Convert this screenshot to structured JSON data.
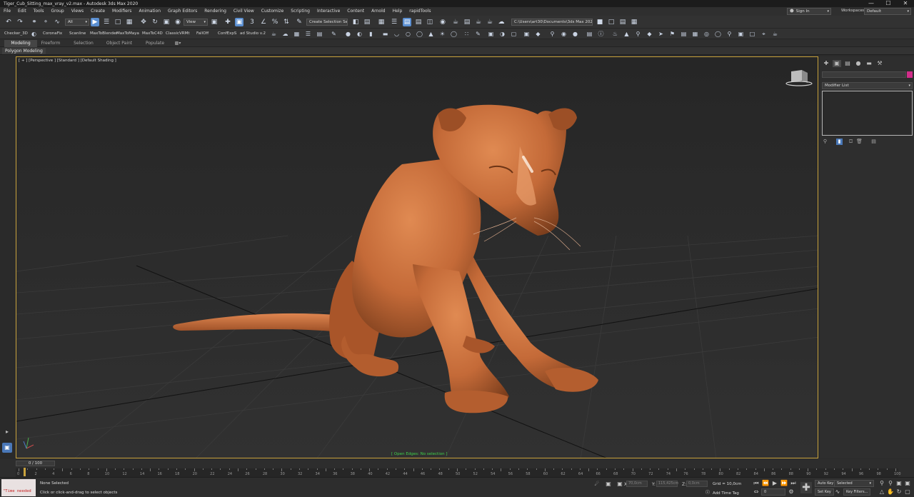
{
  "window": {
    "title": "Tiger_Cub_Sitting_max_vray_v2.max - Autodesk 3ds Max 2020",
    "buttons": {
      "minimize": "—",
      "maximize": "☐",
      "close": "✕"
    }
  },
  "menubar": {
    "items": [
      "File",
      "Edit",
      "Tools",
      "Group",
      "Views",
      "Create",
      "Modifiers",
      "Animation",
      "Graph Editors",
      "Rendering",
      "Civil View",
      "Customize",
      "Scripting",
      "Interactive",
      "Content",
      "Arnold",
      "Help",
      "rapidTools"
    ],
    "sign_in": "Sign In",
    "workspaces_label": "Workspaces:",
    "workspace_value": "Default"
  },
  "toolbar": {
    "selection_filter": "All",
    "ref_coord": "View",
    "named_selection": "Create Selection Se",
    "project_path": "C:\\Users\\art30\\Documents\\3ds Max 2020"
  },
  "toolbar2": {
    "labels": [
      "Checker_3D",
      "CoronaFix",
      "Scanline",
      "MaxToBlender",
      "MaxToMaya",
      "MaxToC4D",
      "ClassicVRMt",
      "FallOff",
      "ConfExpS",
      "ad Studio v.2"
    ]
  },
  "ribbon": {
    "tabs": [
      "Modeling",
      "Freeform",
      "Selection",
      "Object Paint",
      "Populate"
    ],
    "active_tab": "Modeling",
    "group_label": "Polygon Modeling"
  },
  "viewport": {
    "label": "[ + ] [Perspective ] [Standard ] [Default Shading ]",
    "status": "[ Open Edges: No selection ]",
    "model_color": "#c46a38"
  },
  "command_panel": {
    "modifier_list": "Modifier List"
  },
  "timeline": {
    "frame_display": "0 / 100",
    "ticks": [
      "0",
      "2",
      "4",
      "6",
      "8",
      "10",
      "12",
      "14",
      "16",
      "18",
      "20",
      "22",
      "24",
      "26",
      "28",
      "30",
      "32",
      "34",
      "36",
      "38",
      "40",
      "42",
      "44",
      "46",
      "48",
      "50",
      "52",
      "54",
      "56",
      "58",
      "60",
      "62",
      "64",
      "66",
      "68",
      "70",
      "72",
      "74",
      "76",
      "78",
      "80",
      "82",
      "84",
      "86",
      "88",
      "90",
      "92",
      "94",
      "96",
      "98",
      "100"
    ]
  },
  "statusbar": {
    "maxscript_output": "\"Time needed",
    "selection_status": "None Selected",
    "prompt": "Click or click-and-drag to select objects",
    "x_label": "X:",
    "x_value": "70,0cm",
    "y_label": "Y:",
    "y_value": "115,425cm",
    "z_label": "Z:",
    "z_value": "0,0cm",
    "grid": "Grid = 10,0cm",
    "add_time_tag": "Add Time Tag",
    "auto_key": "Auto Key",
    "set_key": "Set Key",
    "selected": "Selected",
    "key_filters": "Key Filters...",
    "current_frame": "0"
  }
}
